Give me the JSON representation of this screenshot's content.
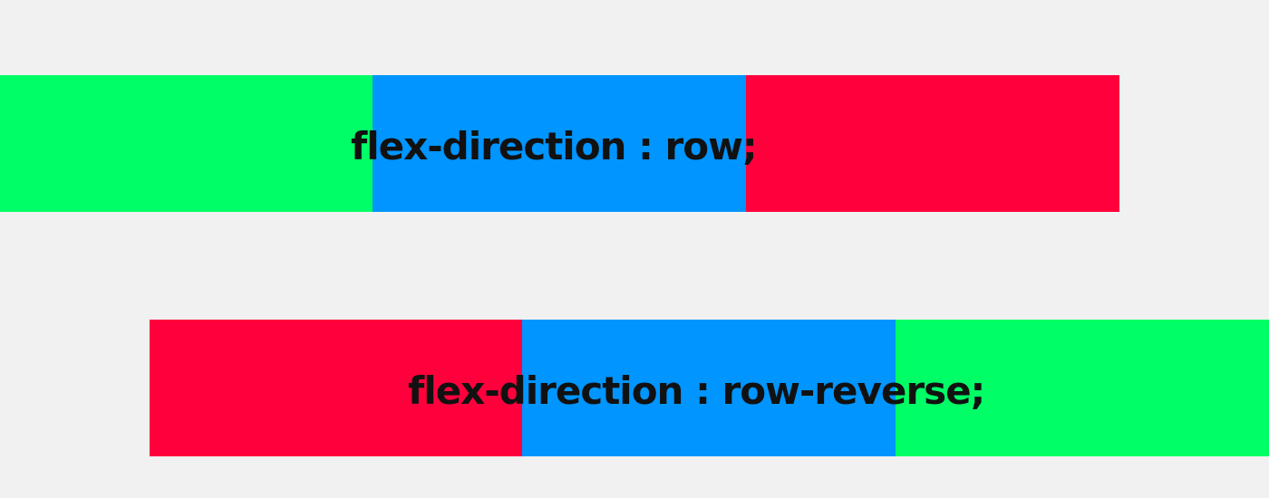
{
  "colors": {
    "background": "#f1f1f1",
    "green": "#00ff66",
    "blue": "#0095ff",
    "red": "#ff003c",
    "text": "#111111"
  },
  "examples": [
    {
      "label": "flex-direction : row;",
      "blocks": [
        "green",
        "blue",
        "red"
      ]
    },
    {
      "label": "flex-direction : row-reverse;",
      "blocks": [
        "red",
        "blue",
        "green"
      ]
    }
  ]
}
